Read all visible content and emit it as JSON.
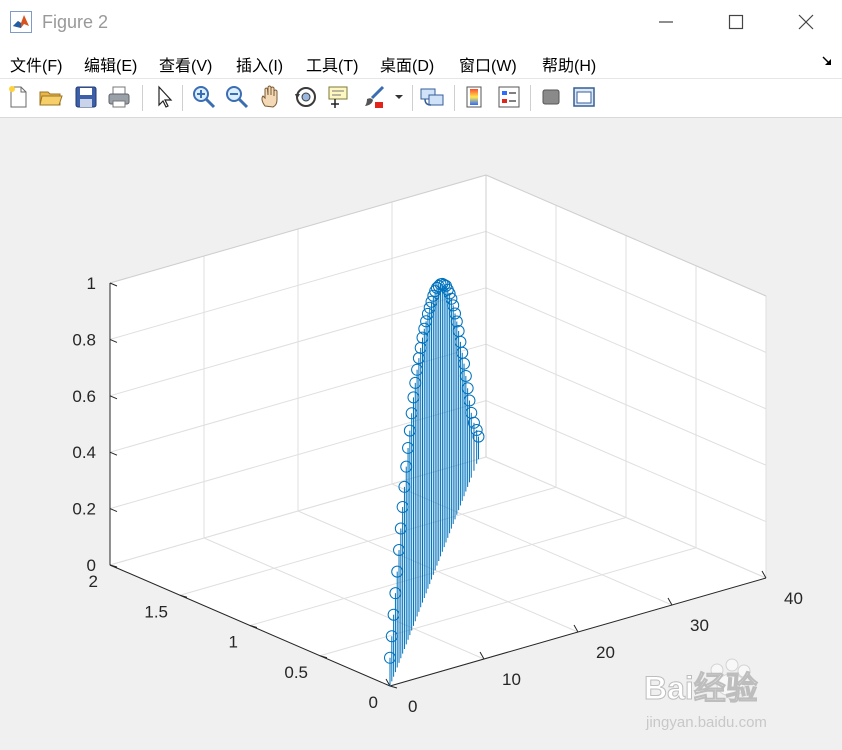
{
  "window": {
    "title": "Figure 2"
  },
  "menu": [
    {
      "label": "文件(F)",
      "name": "menu-file"
    },
    {
      "label": "编辑(E)",
      "name": "menu-edit"
    },
    {
      "label": "查看(V)",
      "name": "menu-view"
    },
    {
      "label": "插入(I)",
      "name": "menu-insert"
    },
    {
      "label": "工具(T)",
      "name": "menu-tools"
    },
    {
      "label": "桌面(D)",
      "name": "menu-desktop"
    },
    {
      "label": "窗口(W)",
      "name": "menu-window"
    },
    {
      "label": "帮助(H)",
      "name": "menu-help"
    }
  ],
  "toolbar_icons": [
    "new-figure-icon",
    "open-file-icon",
    "save-icon",
    "print-icon",
    "pointer-icon",
    "zoom-in-icon",
    "zoom-out-icon",
    "pan-hand-icon",
    "rotate-3d-icon",
    "data-cursor-icon",
    "brush-icon",
    "brush-dropdown-icon",
    "link-plot-icon",
    "colorbar-icon",
    "legend-icon",
    "hide-plot-tools-icon",
    "show-plot-tools-icon"
  ],
  "colors": {
    "stem": "#0072bd",
    "grid": "#dfdfdf",
    "axes": "#262626",
    "figure_bg": "#f0f0f0"
  },
  "watermark": {
    "brand": "Bai经验",
    "url": "jingyan.baidu.com"
  },
  "chart_data": {
    "type": "stem3",
    "x": [
      0,
      0.0408,
      0.0816,
      0.1224,
      0.1633,
      0.2041,
      0.2449,
      0.2857,
      0.3265,
      0.3673,
      0.4082,
      0.449,
      0.4898,
      0.5306,
      0.5714,
      0.6122,
      0.6531,
      0.6939,
      0.7347,
      0.7755,
      0.8163,
      0.8571,
      0.898,
      0.9388,
      0.9796,
      1.0204,
      1.0612,
      1.102,
      1.1429,
      1.1837,
      1.2245,
      1.2653,
      1.3061,
      1.3469,
      1.3878,
      1.4286,
      1.4694,
      1.5102,
      1.551,
      1.5918,
      1.6327,
      1.6735,
      1.7143,
      1.7551,
      1.7959,
      1.8367,
      1.898,
      1.9592,
      2
    ],
    "y": [
      0,
      0.8,
      1.6,
      2.4,
      3.2,
      4,
      4.8,
      5.6,
      6.4,
      7.2,
      8,
      8.8,
      9.6,
      10.4,
      11.2,
      12,
      12.8,
      13.6,
      14.4,
      15.2,
      16,
      16.8,
      17.6,
      18.4,
      19.2,
      20,
      20.8,
      21.6,
      22.4,
      23.2,
      24,
      24.8,
      25.6,
      26.4,
      27.2,
      28,
      28.8,
      29.6,
      30.4,
      31.2,
      32,
      32.8,
      33.6,
      34.4,
      35.2,
      36,
      37.2,
      38.4,
      39.2
    ],
    "z": [
      0.1,
      0.16,
      0.22,
      0.28,
      0.34,
      0.4,
      0.46,
      0.52,
      0.575,
      0.63,
      0.68,
      0.725,
      0.77,
      0.81,
      0.845,
      0.875,
      0.9,
      0.92,
      0.94,
      0.955,
      0.965,
      0.975,
      0.98,
      0.985,
      0.99,
      0.99,
      0.985,
      0.975,
      0.965,
      0.95,
      0.93,
      0.91,
      0.88,
      0.85,
      0.815,
      0.775,
      0.73,
      0.685,
      0.635,
      0.58,
      0.525,
      0.47,
      0.41,
      0.35,
      0.29,
      0.23,
      0.17,
      0.12,
      0.08
    ],
    "xlim": [
      0,
      2
    ],
    "ylim": [
      0,
      40
    ],
    "zlim": [
      0,
      1
    ],
    "xticks": [
      0,
      0.5,
      1,
      1.5,
      2
    ],
    "yticks": [
      0,
      10,
      20,
      30,
      40
    ],
    "zticks": [
      0,
      0.2,
      0.4,
      0.6,
      0.8,
      1
    ],
    "xticklabels": [
      "0",
      "0.5",
      "1",
      "1.5",
      "2"
    ],
    "yticklabels": [
      "0",
      "10",
      "20",
      "30",
      "40"
    ],
    "zticklabels": [
      "0",
      "0.2",
      "0.4",
      "0.6",
      "0.8",
      "1"
    ],
    "grid": true,
    "marker": "circle",
    "title": "",
    "xlabel": "",
    "ylabel": "",
    "zlabel": ""
  }
}
